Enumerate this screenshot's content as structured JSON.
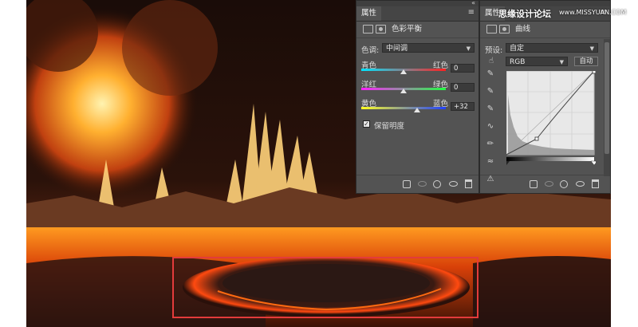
{
  "colors": {
    "highlight_border": "#e33b3b",
    "panel_bg": "#535353",
    "lava": "#ff6a10"
  },
  "watermark": {
    "text": "思缘设计论坛",
    "url": "www.MISSYUAN.COM"
  },
  "panels": {
    "color_balance": {
      "tab": "属性",
      "title": "色彩平衡",
      "tone_label": "色调:",
      "tone_value": "中间调",
      "sliders": [
        {
          "left_label": "青色",
          "right_label": "红色",
          "value": "0",
          "level": 0
        },
        {
          "left_label": "洋红",
          "right_label": "绿色",
          "value": "0",
          "level": 0
        },
        {
          "left_label": "黄色",
          "right_label": "蓝色",
          "value": "+32",
          "level": 32
        }
      ],
      "preserve_label": "保留明度",
      "preserve_checked": true,
      "footer_icons": [
        "clip-to-layer-icon",
        "view-previous-icon",
        "reset-icon",
        "visibility-eye-icon",
        "trash-icon"
      ]
    },
    "curves": {
      "tab": "属性",
      "title": "曲线",
      "preset_label": "预设:",
      "preset_value": "自定",
      "channel_value": "RGB",
      "auto_label": "自动",
      "tools": [
        "eyedropper-black-icon",
        "eyedropper-gray-icon",
        "eyedropper-white-icon",
        "curve-point-icon",
        "pencil-icon",
        "smooth-icon",
        "warning-icon"
      ],
      "footer_icons": [
        "clip-to-layer-icon",
        "view-previous-icon",
        "reset-icon",
        "visibility-eye-icon",
        "trash-icon"
      ]
    }
  }
}
